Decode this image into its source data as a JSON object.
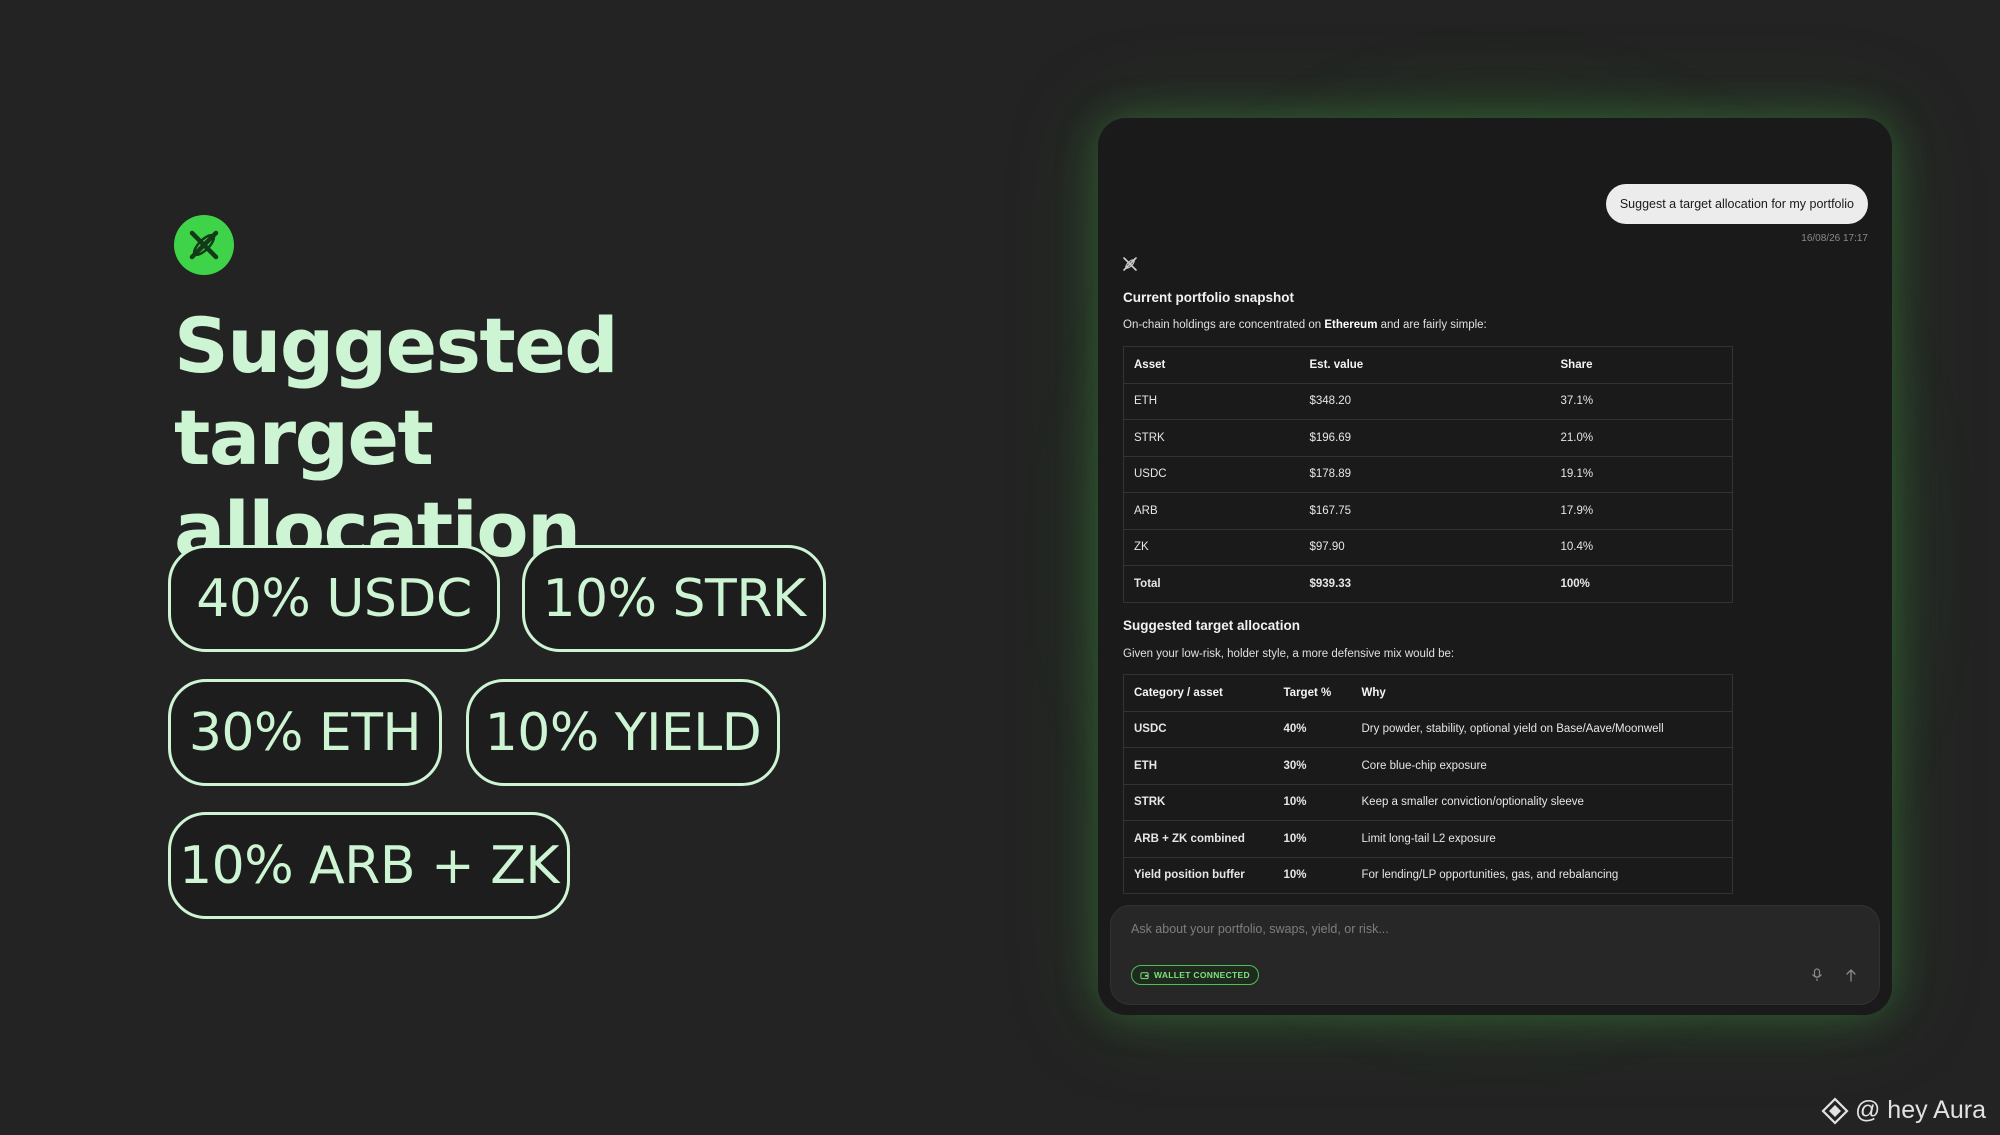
{
  "headline": {
    "line1": "Suggested target",
    "line2": "allocation"
  },
  "pills": [
    "40% USDC",
    "10% STRK",
    "30% ETH",
    "10% YIELD",
    "10% ARB + ZK"
  ],
  "chat": {
    "user_message": "Suggest a target allocation for my portfolio",
    "timestamp": "16/08/26 17:17",
    "snapshot": {
      "title": "Current portfolio snapshot",
      "intro_before": "On-chain holdings are concentrated on ",
      "intro_bold": "Ethereum",
      "intro_after": " and are fairly simple:",
      "headers": [
        "Asset",
        "Est. value",
        "Share"
      ],
      "rows": [
        [
          "ETH",
          "$348.20",
          "37.1%"
        ],
        [
          "STRK",
          "$196.69",
          "21.0%"
        ],
        [
          "USDC",
          "$178.89",
          "19.1%"
        ],
        [
          "ARB",
          "$167.75",
          "17.9%"
        ],
        [
          "ZK",
          "$97.90",
          "10.4%"
        ]
      ],
      "total": [
        "Total",
        "$939.33",
        "100%"
      ]
    },
    "target": {
      "title": "Suggested target allocation",
      "intro": "Given your low-risk, holder style, a more defensive mix would be:",
      "headers": [
        "Category / asset",
        "Target %",
        "Why"
      ],
      "rows": [
        [
          "USDC",
          "40%",
          "Dry powder, stability, optional yield on Base/Aave/Moonwell"
        ],
        [
          "ETH",
          "30%",
          "Core blue-chip exposure"
        ],
        [
          "STRK",
          "10%",
          "Keep a smaller conviction/optionality sleeve"
        ],
        [
          "ARB + ZK combined",
          "10%",
          "Limit long-tail L2 exposure"
        ],
        [
          "Yield position buffer",
          "10%",
          "For lending/LP opportunities, gas, and rebalancing"
        ]
      ]
    },
    "input": {
      "placeholder": "Ask about your portfolio, swaps, yield, or risk...",
      "wallet_badge": "WALLET CONNECTED"
    }
  },
  "watermark": "@ hey Aura",
  "icons": {
    "brand": "brand-logo-icon",
    "bot": "bot-avatar-icon",
    "wallet": "wallet-icon",
    "mic": "mic-icon",
    "send": "send-arrow-icon",
    "watermark": "watermark-logo-icon"
  },
  "colors": {
    "background": "#232323",
    "accent_text": "#cdf4d3",
    "brand_green": "#3fd34a",
    "chat_bg": "#1a1a1a",
    "badge_green": "#7ee07f"
  }
}
